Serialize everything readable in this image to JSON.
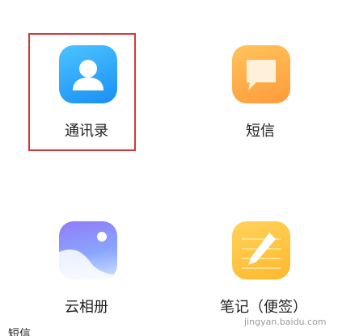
{
  "apps": [
    {
      "label": "通讯录",
      "icon": "contacts-icon",
      "color": "#2a9df7",
      "highlighted": true
    },
    {
      "label": "短信",
      "icon": "message-icon",
      "color": "#ffad45",
      "highlighted": false
    },
    {
      "label": "云相册",
      "icon": "gallery-icon",
      "color": "#8f9cf8",
      "highlighted": false
    },
    {
      "label": "笔记（便签）",
      "icon": "notes-icon",
      "color": "#ffc43d",
      "highlighted": false
    }
  ],
  "highlight_color": "#d23a3a",
  "watermark": "jingyan.baidu.com",
  "bottom_text": "…短信"
}
